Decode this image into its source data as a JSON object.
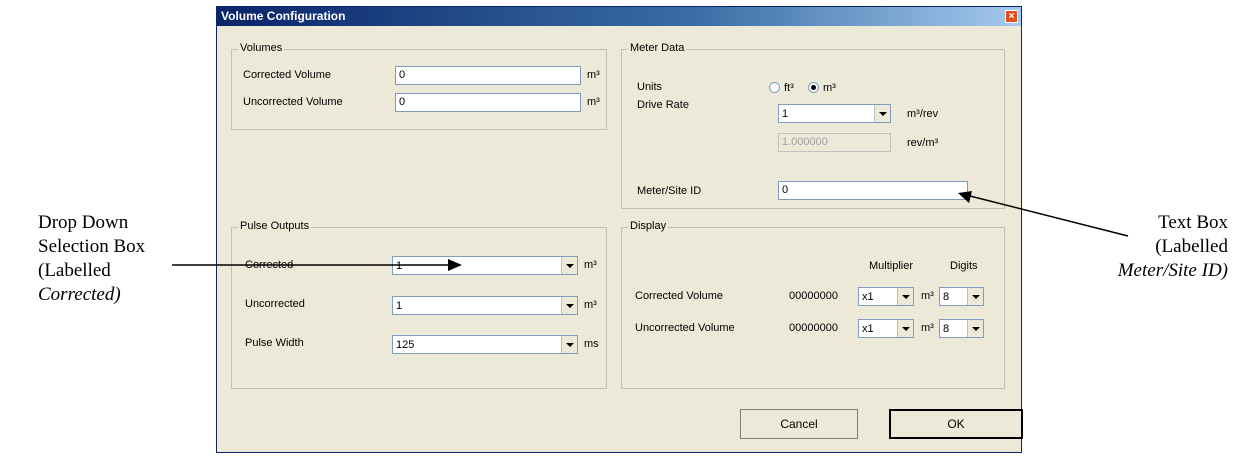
{
  "annotations": {
    "left": {
      "line1": "Drop Down",
      "line2": "Selection Box",
      "line3": "(Labelled",
      "line4": "Corrected)"
    },
    "right": {
      "line1": "Text Box",
      "line2": "(Labelled",
      "line3": "Meter/Site ID)"
    }
  },
  "window": {
    "title": "Volume Configuration",
    "close_label": "×"
  },
  "volumes": {
    "legend": "Volumes",
    "corrected": {
      "label": "Corrected Volume",
      "value": "0",
      "unit": "m³"
    },
    "uncorrected": {
      "label": "Uncorrected Volume",
      "value": "0",
      "unit": "m³"
    }
  },
  "meter_data": {
    "legend": "Meter Data",
    "units_label": "Units",
    "units_options": [
      {
        "label": "ft³",
        "selected": false
      },
      {
        "label": "m³",
        "selected": true
      }
    ],
    "drive_rate_label": "Drive Rate",
    "drive_rate_value": "1",
    "drive_rate_unit": "m³/rev",
    "rev_value": "1.000000",
    "rev_unit": "rev/m³",
    "site_id_label": "Meter/Site ID",
    "site_id_value": "0"
  },
  "pulse_outputs": {
    "legend": "Pulse Outputs",
    "corrected": {
      "label": "Corrected",
      "value": "1",
      "unit": "m³"
    },
    "uncorrected": {
      "label": "Uncorrected",
      "value": "1",
      "unit": "m³"
    },
    "pulse_width": {
      "label": "Pulse Width",
      "value": "125",
      "unit": "ms"
    }
  },
  "display": {
    "legend": "Display",
    "multiplier_header": "Multiplier",
    "digits_header": "Digits",
    "rows": [
      {
        "label": "Corrected Volume",
        "readout": "00000000",
        "multiplier": "x1",
        "unit": "m³",
        "digits": "8"
      },
      {
        "label": "Uncorrected Volume",
        "readout": "00000000",
        "multiplier": "x1",
        "unit": "m³",
        "digits": "8"
      }
    ]
  },
  "buttons": {
    "cancel": "Cancel",
    "ok": "OK"
  }
}
